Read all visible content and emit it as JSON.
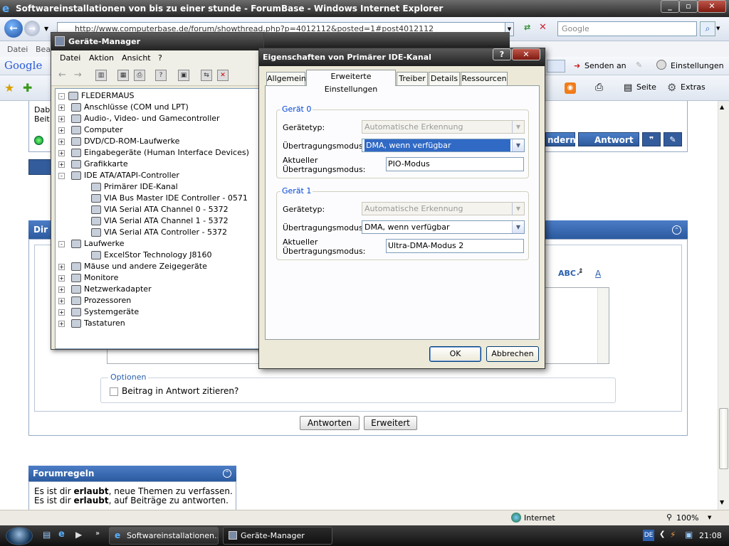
{
  "ie": {
    "title": "Softwareinstallationen von bis zu einer stunde - ForumBase - Windows Internet Explorer",
    "address": "http://www.computerbase.de/forum/showthread.php?p=4012112&posted=1#post4012112",
    "search_placeholder": "Google",
    "menu": [
      "Datei",
      "Bea"
    ],
    "google_logo": "Google",
    "toolbar": {
      "senden": "Senden an",
      "einstellungen": "Einstellungen",
      "seite": "Seite",
      "extras": "Extras"
    },
    "status_zone": "Internet",
    "zoom": "100%"
  },
  "page": {
    "snippet_1": "Dab",
    "snippet_2": "Beit",
    "btn_aendern": "ndern",
    "btn_antwort": "Antwort",
    "section_title": "Dir",
    "optionen_label": "Optionen",
    "quote_checkbox": "Beitrag in Antwort zitieren?",
    "btn_antworten": "Antworten",
    "btn_erweitert": "Erweitert",
    "forumregeln_title": "Forumregeln",
    "rule_1_prefix": "Es ist dir ",
    "rule_1_bold": "erlaubt",
    "rule_1_suffix": ", neue Themen zu verfassen.",
    "rule_2_prefix": "Es ist dir ",
    "rule_2_bold": "erlaubt",
    "rule_2_suffix": ", auf Beiträge zu antworten."
  },
  "devmgr": {
    "title": "Geräte-Manager",
    "menu": [
      "Datei",
      "Aktion",
      "Ansicht",
      "?"
    ],
    "tree": [
      {
        "label": "FLEDERMAUS",
        "level": 0,
        "exp": "-"
      },
      {
        "label": "Anschlüsse (COM und LPT)",
        "level": 1,
        "exp": "+"
      },
      {
        "label": "Audio-, Video- und Gamecontroller",
        "level": 1,
        "exp": "+"
      },
      {
        "label": "Computer",
        "level": 1,
        "exp": "+"
      },
      {
        "label": "DVD/CD-ROM-Laufwerke",
        "level": 1,
        "exp": "+"
      },
      {
        "label": "Eingabegeräte (Human Interface Devices)",
        "level": 1,
        "exp": "+"
      },
      {
        "label": "Grafikkarte",
        "level": 1,
        "exp": "+"
      },
      {
        "label": "IDE ATA/ATAPI-Controller",
        "level": 1,
        "exp": "-"
      },
      {
        "label": "Primärer IDE-Kanal",
        "level": 2,
        "exp": ""
      },
      {
        "label": "VIA Bus Master IDE Controller - 0571",
        "level": 2,
        "exp": ""
      },
      {
        "label": "VIA Serial ATA Channel 0 - 5372",
        "level": 2,
        "exp": ""
      },
      {
        "label": "VIA Serial ATA Channel 1 - 5372",
        "level": 2,
        "exp": ""
      },
      {
        "label": "VIA Serial ATA Controller - 5372",
        "level": 2,
        "exp": ""
      },
      {
        "label": "Laufwerke",
        "level": 1,
        "exp": "-"
      },
      {
        "label": "ExcelStor Technology J8160",
        "level": 2,
        "exp": ""
      },
      {
        "label": "Mäuse und andere Zeigegeräte",
        "level": 1,
        "exp": "+"
      },
      {
        "label": "Monitore",
        "level": 1,
        "exp": "+"
      },
      {
        "label": "Netzwerkadapter",
        "level": 1,
        "exp": "+"
      },
      {
        "label": "Prozessoren",
        "level": 1,
        "exp": "+"
      },
      {
        "label": "Systemgeräte",
        "level": 1,
        "exp": "+"
      },
      {
        "label": "Tastaturen",
        "level": 1,
        "exp": "+"
      }
    ]
  },
  "dialog": {
    "title": "Eigenschaften von Primärer IDE-Kanal",
    "tabs": [
      "Allgemein",
      "Erweiterte Einstellungen",
      "Treiber",
      "Details",
      "Ressourcen"
    ],
    "active_tab": "Erweiterte Einstellungen",
    "device0": {
      "label": "Gerät 0",
      "typ_label": "Gerätetyp:",
      "typ_value": "Automatische Erkennung",
      "modus_label": "Übertragungsmodus:",
      "modus_value": "DMA, wenn verfügbar",
      "current_label_1": "Aktueller",
      "current_label_2": "Übertragungsmodus:",
      "current_value": "PIO-Modus"
    },
    "device1": {
      "label": "Gerät 1",
      "typ_label": "Gerätetyp:",
      "typ_value": "Automatische Erkennung",
      "modus_label": "Übertragungsmodus:",
      "modus_value": "DMA, wenn verfügbar",
      "current_label_1": "Aktueller",
      "current_label_2": "Übertragungsmodus:",
      "current_value": "Ultra-DMA-Modus 2"
    },
    "ok": "OK",
    "cancel": "Abbrechen"
  },
  "taskbar": {
    "task1": "Softwareinstallationen...",
    "task2": "Geräte-Manager",
    "lang": "DE",
    "clock": "21:08"
  }
}
